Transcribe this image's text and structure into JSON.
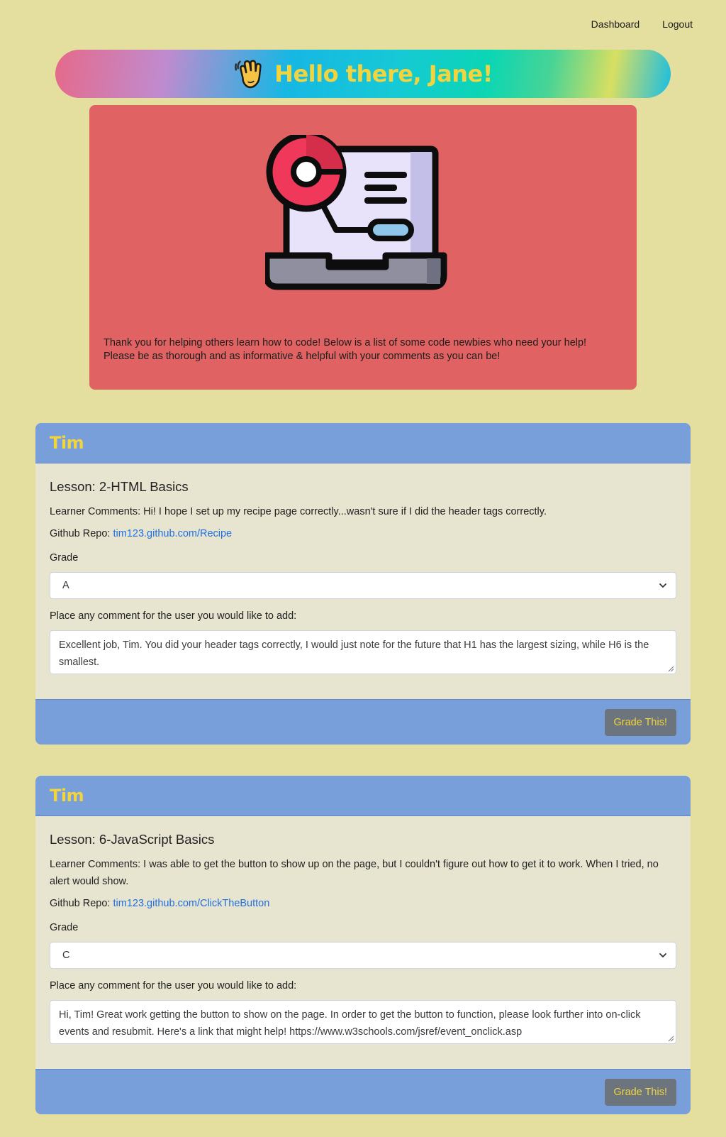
{
  "nav": {
    "dashboard_label": "Dashboard",
    "logout_label": "Logout"
  },
  "banner": {
    "title": "Hello there, Jane!",
    "icon": "waving-hand-icon"
  },
  "intro": {
    "illustration": "laptop-chart-icon",
    "line1": "Thank you for helping others learn how to code! Below is a list of some code newbies who need your help!",
    "line2": "Please be as thorough and as informative & helpful with your comments as you can be!"
  },
  "colors": {
    "background": "#e4df9f",
    "intro_panel": "#e06262",
    "card_header": "#789fd9",
    "card_body": "#e7e4d0",
    "accent_yellow": "#f2d43e",
    "button": "#6c757d",
    "link": "#1f6fe0"
  },
  "submissions": [
    {
      "name": "Tim",
      "lesson": "Lesson: 2-HTML Basics",
      "comments_label": "Learner Comments:",
      "comments": "Hi! I hope I set up my recipe page correctly...wasn't sure if I did the header tags correctly.",
      "repo_label": "Github Repo:",
      "repo_link": "tim123.github.com/Recipe",
      "grade_label": "Grade",
      "grade_value": "A",
      "comment_prompt": "Place any comment for the user you would like to add:",
      "reviewer_comment": "Excellent job, Tim. You did your header tags correctly, I would just note for the future that H1 has the largest sizing, while H6 is the smallest.",
      "button_label": "Grade This!"
    },
    {
      "name": "Tim",
      "lesson": "Lesson: 6-JavaScript Basics",
      "comments_label": "Learner Comments:",
      "comments": "I was able to get the button to show up on the page, but I couldn't figure out how to get it to work. When I tried, no alert would show.",
      "repo_label": "Github Repo:",
      "repo_link": "tim123.github.com/ClickTheButton",
      "grade_label": "Grade",
      "grade_value": "C",
      "comment_prompt": "Place any comment for the user you would like to add:",
      "reviewer_comment": "Hi, Tim! Great work getting the button to show on the page. In order to get the button to function, please look further into on-click events and resubmit. Here's a link that might help! https://www.w3schools.com/jsref/event_onclick.asp",
      "button_label": "Grade This!"
    }
  ]
}
